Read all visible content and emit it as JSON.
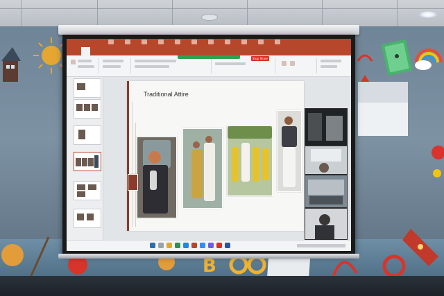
{
  "slide": {
    "title": "Traditional Attire"
  },
  "meeting": {
    "banner": "Stop Share"
  },
  "colors": {
    "ribbon": "#b7472a",
    "indicator": "#2fa24a",
    "stop": "#d93025"
  },
  "icons": [
    "window-icon",
    "sun-icon",
    "book-icon",
    "rainbow-icon",
    "rocket-icon",
    "paintbrush-icon"
  ]
}
